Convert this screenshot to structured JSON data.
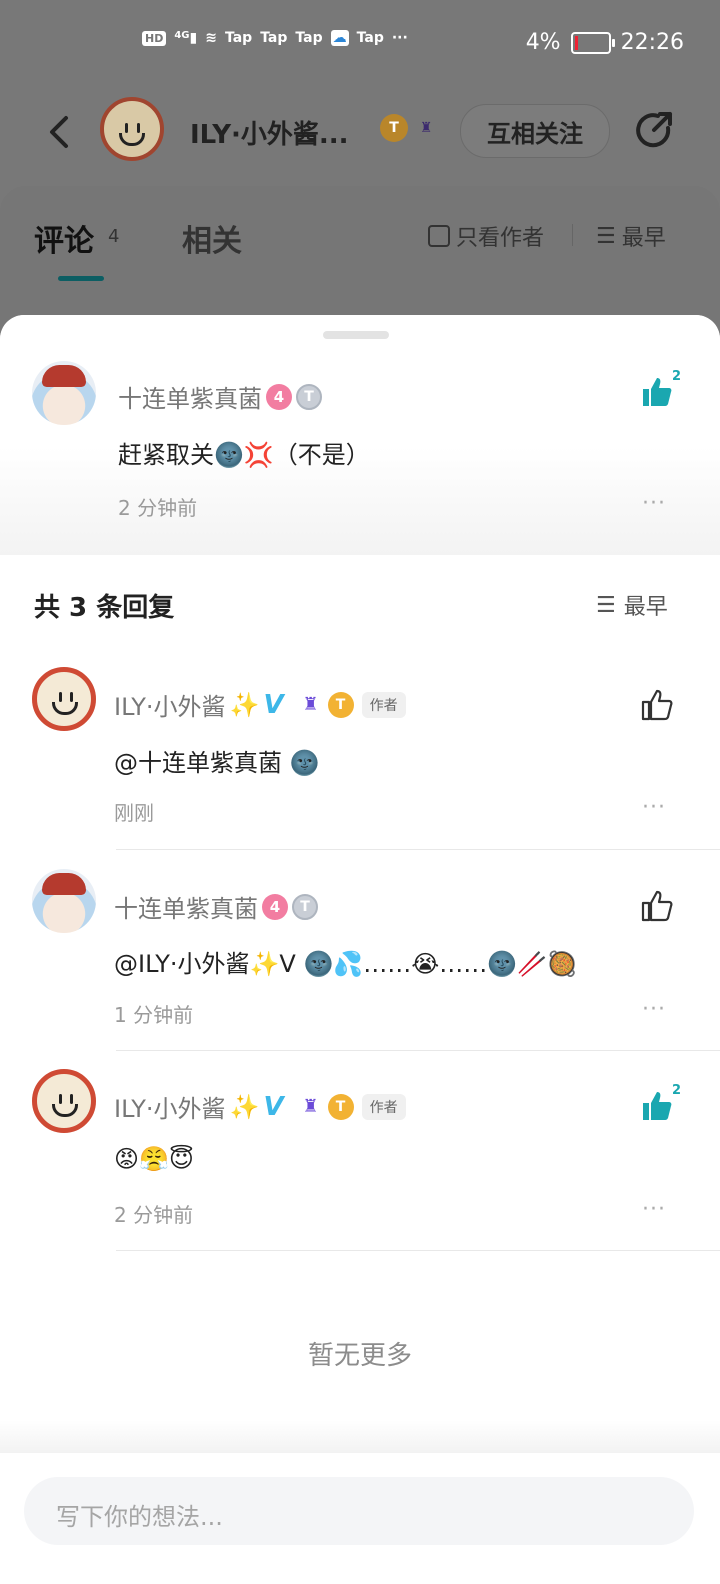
{
  "status_bar": {
    "left_label": "HD",
    "signal_label": "4G",
    "apps": [
      "Tap",
      "Tap",
      "Tap",
      "Tap"
    ],
    "more": "···",
    "battery": "4%",
    "time": "22:26"
  },
  "top_nav": {
    "name": "ILY·小外酱...",
    "badge_gold": "T",
    "follow_label": "互相关注"
  },
  "tabs": {
    "comment_label": "评论",
    "comment_count": "4",
    "related_label": "相关",
    "only_author_label": "只看作者",
    "sort_label": "最早"
  },
  "parent_comment": {
    "user": "十连单紫真菌",
    "level": "4",
    "badge": "T",
    "content": "赶紧取关🌚💢（不是）",
    "time": "2 分钟前",
    "likes": "2",
    "more": "···"
  },
  "replies_header": {
    "title": "共 3 条回复",
    "sort_label": "最早"
  },
  "replies": [
    {
      "user": "ILY·小外酱",
      "sparkle": "✨",
      "v": "V",
      "author_tag": "作者",
      "gold": "T",
      "content": "@十连单紫真菌 🌚",
      "time": "刚刚",
      "likes": "",
      "more": "···"
    },
    {
      "user": "十连单紫真菌",
      "level": "4",
      "badge": "T",
      "content": "@ILY·小外酱✨V 🌚💦……😭……🌚🥢🥘",
      "time": "1 分钟前",
      "likes": "",
      "more": "···"
    },
    {
      "user": "ILY·小外酱",
      "sparkle": "✨",
      "v": "V",
      "author_tag": "作者",
      "gold": "T",
      "content": "😡😤😇",
      "time": "2 分钟前",
      "likes": "2",
      "more": "···"
    }
  ],
  "no_more": "暂无更多",
  "input_placeholder": "写下你的想法..."
}
